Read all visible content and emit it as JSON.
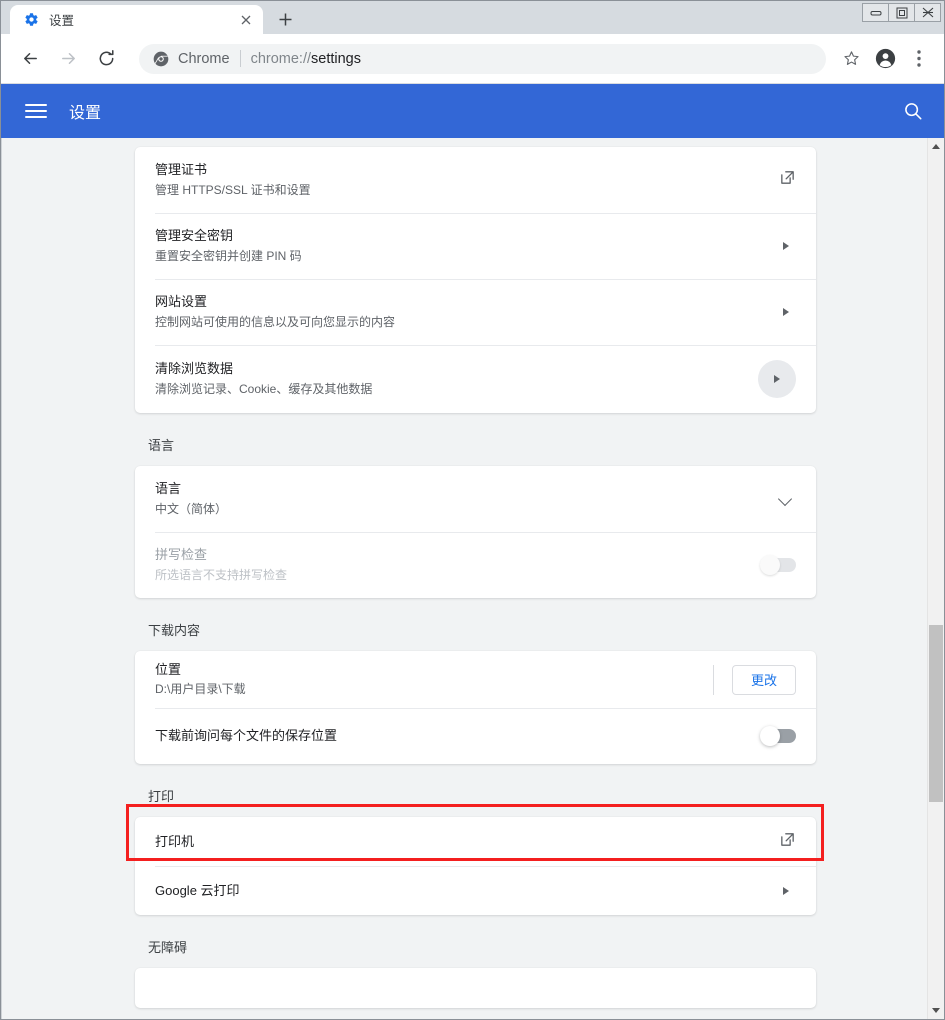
{
  "window": {
    "controls": [
      {
        "name": "minimize",
        "label": "–"
      },
      {
        "name": "maximize",
        "label": "❐"
      },
      {
        "name": "close",
        "label": "✕"
      }
    ]
  },
  "tabstrip": {
    "tab": {
      "title": "设置",
      "favicon": "gear-icon",
      "close_label": "✕"
    },
    "newtab_label": "+"
  },
  "toolbar": {
    "back": "back-arrow-icon",
    "forward": "forward-arrow-icon",
    "reload": "reload-icon",
    "omnibox": {
      "site_icon": "chrome-icon",
      "site_label": "Chrome",
      "url_scheme": "chrome://",
      "url_path": "settings",
      "full_url": "chrome://settings"
    },
    "bookmark": "star-icon",
    "profile": "account-avatar-icon",
    "menu": "three-dot-menu-icon"
  },
  "settings_header": {
    "menu_label": "hamburger-menu-icon",
    "title": "设置",
    "search_label": "search-icon",
    "accent_color": "#3367d6"
  },
  "sections": [
    {
      "id": "privacy-continued",
      "heading": null,
      "rows": [
        {
          "title": "管理证书",
          "sub": "管理 HTTPS/SSL 证书和设置",
          "action": "external-link"
        },
        {
          "title": "管理安全密钥",
          "sub": "重置安全密钥并创建 PIN 码",
          "action": "arrow"
        },
        {
          "title": "网站设置",
          "sub": "控制网站可使用的信息以及可向您显示的内容",
          "action": "arrow"
        },
        {
          "title": "清除浏览数据",
          "sub": "清除浏览记录、Cookie、缓存及其他数据",
          "action": "arrow-circle"
        }
      ]
    },
    {
      "id": "languages",
      "heading": "语言",
      "rows": [
        {
          "title": "语言",
          "sub": "中文（简体）",
          "action": "chevron-down"
        },
        {
          "title": "拼写检查",
          "sub": "所选语言不支持拼写检查",
          "action": "toggle-disabled",
          "disabled": true
        }
      ]
    },
    {
      "id": "downloads",
      "heading": "下载内容",
      "rows": [
        {
          "title": "位置",
          "sub": "D:\\用户目录\\下载",
          "action": "change-button",
          "button_label": "更改",
          "highlighted": true
        },
        {
          "title": "下载前询问每个文件的保存位置",
          "sub": null,
          "action": "toggle-off"
        }
      ]
    },
    {
      "id": "printing",
      "heading": "打印",
      "rows": [
        {
          "title": "打印机",
          "sub": null,
          "action": "external-link"
        },
        {
          "title": "Google 云打印",
          "sub": null,
          "action": "arrow"
        }
      ]
    },
    {
      "id": "accessibility",
      "heading": "无障碍",
      "rows": []
    }
  ],
  "annotation": {
    "color": "#f41f1f",
    "target": "downloads-location-row"
  },
  "scrollbar": {
    "up_label": "▲",
    "down_label": "▼"
  }
}
